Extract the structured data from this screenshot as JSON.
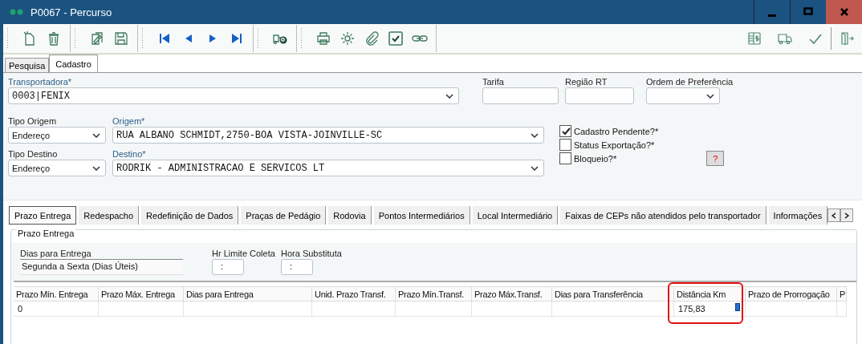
{
  "window": {
    "title": "P0067 - Percurso"
  },
  "main_tabs": [
    {
      "label": "Pesquisa",
      "selected": false
    },
    {
      "label": "Cadastro",
      "selected": true
    }
  ],
  "transportadora": {
    "label": "Transportadora*",
    "value": "0003|FENIX"
  },
  "tarifa": {
    "label": "Tarifa"
  },
  "regiao_rt": {
    "label": "Região RT"
  },
  "ordem_preferencia": {
    "label": "Ordem de Preferência"
  },
  "tipo_origem": {
    "label": "Tipo Origem",
    "value": "Endereço"
  },
  "origem": {
    "label": "Origem*",
    "value": "RUA ALBANO SCHMIDT,2750-BOA VISTA-JOINVILLE-SC"
  },
  "tipo_destino": {
    "label": "Tipo Destino",
    "value": "Endereço"
  },
  "destino": {
    "label": "Destino*",
    "value": "RODRIK - ADMINISTRACAO E SERVICOS LT"
  },
  "checkboxes": [
    {
      "label": "Cadastro Pendente?*",
      "checked": true
    },
    {
      "label": "Status Exportação?*",
      "checked": false
    },
    {
      "label": "Bloqueio?*",
      "checked": false
    }
  ],
  "help_button": "?",
  "sub_tabs": [
    {
      "label": "Prazo Entrega",
      "selected": true
    },
    {
      "label": "Redespacho",
      "selected": false
    },
    {
      "label": "Redefinição de Dados",
      "selected": false
    },
    {
      "label": "Praças de Pedágio",
      "selected": false
    },
    {
      "label": "Rodovia",
      "selected": false
    },
    {
      "label": "Pontos Intermediários",
      "selected": false
    },
    {
      "label": "Local Intermediário",
      "selected": false
    },
    {
      "label": "Faixas de CEPs não atendidos pelo transportador",
      "selected": false
    },
    {
      "label": "Informações",
      "selected": false
    }
  ],
  "group": {
    "title": "Prazo Entrega",
    "dias_label": "Dias para Entrega",
    "dias_value": "Segunda a Sexta (Dias Úteis)",
    "hr_limite_label": "Hr Limite Coleta",
    "hr_limite_value": ":",
    "hora_subst_label": "Hora Substituta",
    "hora_subst_value": ":"
  },
  "table": {
    "columns": [
      "Prazo Mín. Entrega",
      "Prazo Máx. Entrega",
      "Dias para Entrega",
      "Unid. Prazo Transf.",
      "Prazo Mín.Transf.",
      "Prazo Máx.Transf.",
      "Dias para Transferência",
      "Distância Km",
      "Prazo de Prorrogação",
      "P"
    ],
    "rows": [
      [
        "0",
        "",
        "",
        "",
        "",
        "",
        "",
        "175,83",
        "",
        ""
      ]
    ]
  }
}
